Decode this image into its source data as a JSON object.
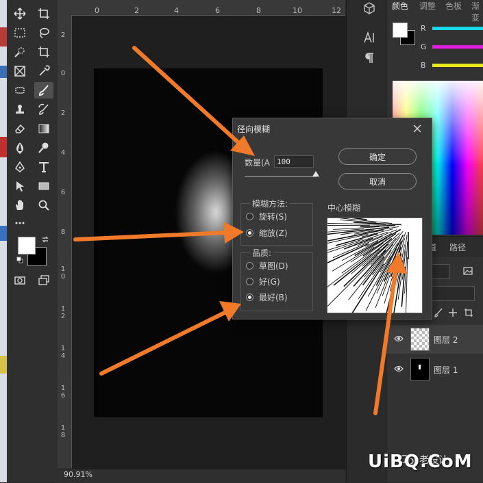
{
  "colors": {
    "accent_arrow": "#f07a2a",
    "panel_bg": "#323232",
    "dialog_bg": "#383838"
  },
  "ruler": {
    "top": [
      "0",
      "2",
      "4",
      "6",
      "8",
      "10",
      "12"
    ],
    "left": [
      "2",
      "0",
      "2",
      "4",
      "6",
      "8",
      "1\n0",
      "1\n2",
      "1\n4",
      "1\n6",
      "1\n8"
    ]
  },
  "status": {
    "zoom": "90.91%"
  },
  "tools": [
    "move-icon",
    "artboard-icon",
    "marquee-icon",
    "lasso-icon",
    "quick-select-icon",
    "crop-icon",
    "frame-icon",
    "eyedropper-icon",
    "healing-icon",
    "brush-icon",
    "stamp-icon",
    "history-brush-icon",
    "eraser-icon",
    "gradient-icon",
    "blur-icon",
    "dodge-icon",
    "pen-icon",
    "type-icon",
    "path-select-icon",
    "rectangle-icon",
    "hand-icon",
    "zoom-icon",
    "more-icon"
  ],
  "right_panel": {
    "tabs": [
      "颜色",
      "调整",
      "色板",
      "渐变"
    ],
    "channels": [
      {
        "label": "R",
        "color": "#19d8e8"
      },
      {
        "label": "G",
        "color": "#e01ce0"
      },
      {
        "label": "B",
        "color": "#e8e81a"
      }
    ],
    "layers_tabs": [
      "道",
      "路径"
    ],
    "layers": [
      {
        "name": "图层 2"
      },
      {
        "name": "图层 1"
      }
    ]
  },
  "mid_panel": {
    "icons": [
      "cube-icon",
      "character-icon",
      "paragraph-icon"
    ]
  },
  "dialog": {
    "title": "径向模糊",
    "amount_label": "数量(A",
    "amount_value": "100",
    "ok_label": "确定",
    "cancel_label": "取消",
    "method_title": "模糊方法:",
    "methods": [
      {
        "label": "旋转(S)",
        "selected": false
      },
      {
        "label": "缩放(Z)",
        "selected": true
      }
    ],
    "quality_title": "品质:",
    "qualities": [
      {
        "label": "草图(D)",
        "selected": false
      },
      {
        "label": "好(G)",
        "selected": false
      },
      {
        "label": "最好(B)",
        "selected": true
      }
    ],
    "center_label": "中心模糊"
  },
  "watermark": {
    "text": "UiBQ.CoM",
    "cn": "老设计"
  }
}
